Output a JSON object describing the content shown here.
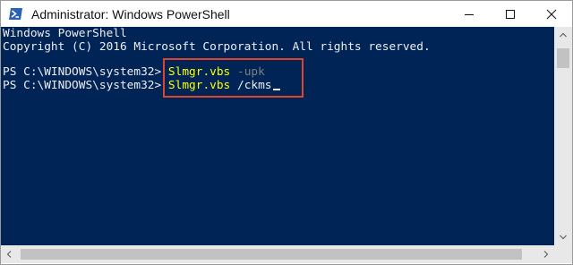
{
  "window": {
    "title": "Administrator: Windows PowerShell",
    "app_icon": "powershell-icon",
    "controls": {
      "minimize_icon": "minimize-icon",
      "maximize_icon": "maximize-icon",
      "close_icon": "close-icon"
    }
  },
  "console": {
    "background": "#012456",
    "text_color": "#eeedf0",
    "command_color": "#ffff00",
    "parameter_color": "#7f7f7f",
    "header_lines": [
      "Windows PowerShell",
      "Copyright (C) 2016 Microsoft Corporation. All rights reserved."
    ],
    "commands": [
      {
        "prompt": "PS C:\\WINDOWS\\system32>",
        "command": "Slmgr.vbs",
        "argument": "-upk"
      },
      {
        "prompt": "PS C:\\WINDOWS\\system32>",
        "command": "Slmgr.vbs",
        "argument": "/ckms"
      }
    ],
    "highlight_color": "#e0442b"
  }
}
